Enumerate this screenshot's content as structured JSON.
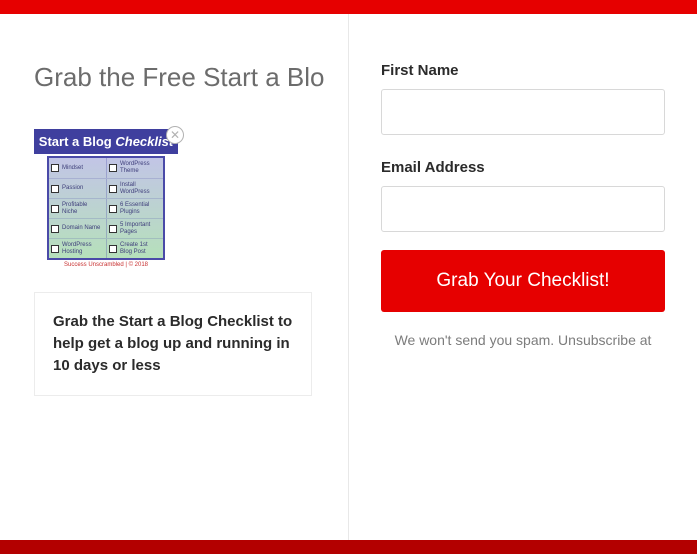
{
  "left": {
    "title": "Grab the Free Start a Blo",
    "banner_plain": "Start a Blog",
    "banner_italic": " Checklist",
    "checklist": [
      [
        "Mindset",
        "WordPress Theme"
      ],
      [
        "Passion",
        "Install WordPress"
      ],
      [
        "Profitable Niche",
        "6 Essential Plugins"
      ],
      [
        "Domain Name",
        "5 Important Pages"
      ],
      [
        "WordPress Hosting",
        "Create 1st Blog Post"
      ]
    ],
    "copyright": "Success Unscrambled | © 2018",
    "caption": "Grab the Start a Blog Checklist to help get a blog up and running in 10 days or less"
  },
  "form": {
    "first_name_label": "First Name",
    "email_label": "Email Address",
    "submit_label": "Grab Your Checklist!",
    "disclaimer": "We won't send you spam. Unsubscribe at"
  }
}
